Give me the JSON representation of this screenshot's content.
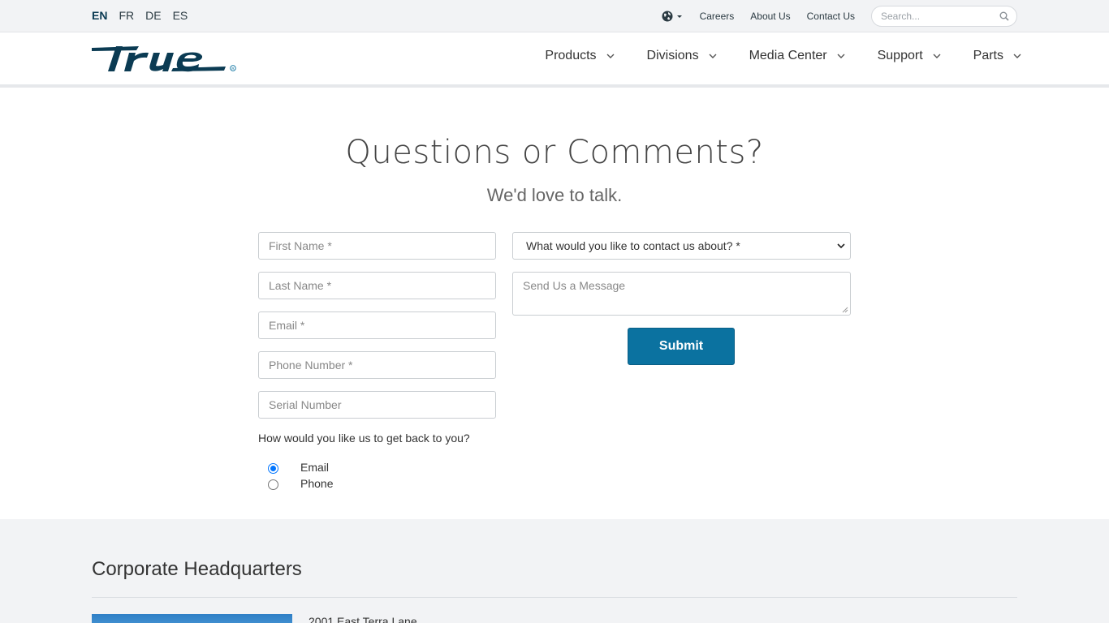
{
  "utility_bar": {
    "languages": [
      {
        "code": "EN",
        "active": true
      },
      {
        "code": "FR",
        "active": false
      },
      {
        "code": "DE",
        "active": false
      },
      {
        "code": "ES",
        "active": false
      }
    ],
    "globe_icon": "globe-icon",
    "links": [
      "Careers",
      "About Us",
      "Contact Us"
    ],
    "search_placeholder": "Search..."
  },
  "nav": {
    "logo_icon": "true-logo",
    "items": [
      "Products",
      "Divisions",
      "Media Center",
      "Support",
      "Parts"
    ]
  },
  "form": {
    "heading": "Questions or Comments?",
    "subheading": "We'd love to talk.",
    "fields": {
      "first_name": "First Name *",
      "last_name": "Last Name *",
      "email": "Email *",
      "phone": "Phone Number *",
      "serial": "Serial Number"
    },
    "topic_select": "What would you like to contact us about? *",
    "message_placeholder": "Send Us a Message",
    "submit_label": "Submit",
    "contact_question": "How would you like us to get back to you?",
    "contact_options": [
      {
        "label": "Email",
        "checked": true
      },
      {
        "label": "Phone",
        "checked": false
      }
    ]
  },
  "headquarters": {
    "title": "Corporate Headquarters",
    "address_line": "2001 East Terra Lane"
  },
  "colors": {
    "brand_dark": "#0b3b53",
    "submit_blue": "#0b72a0",
    "utility_bg": "#f2f3f5"
  }
}
